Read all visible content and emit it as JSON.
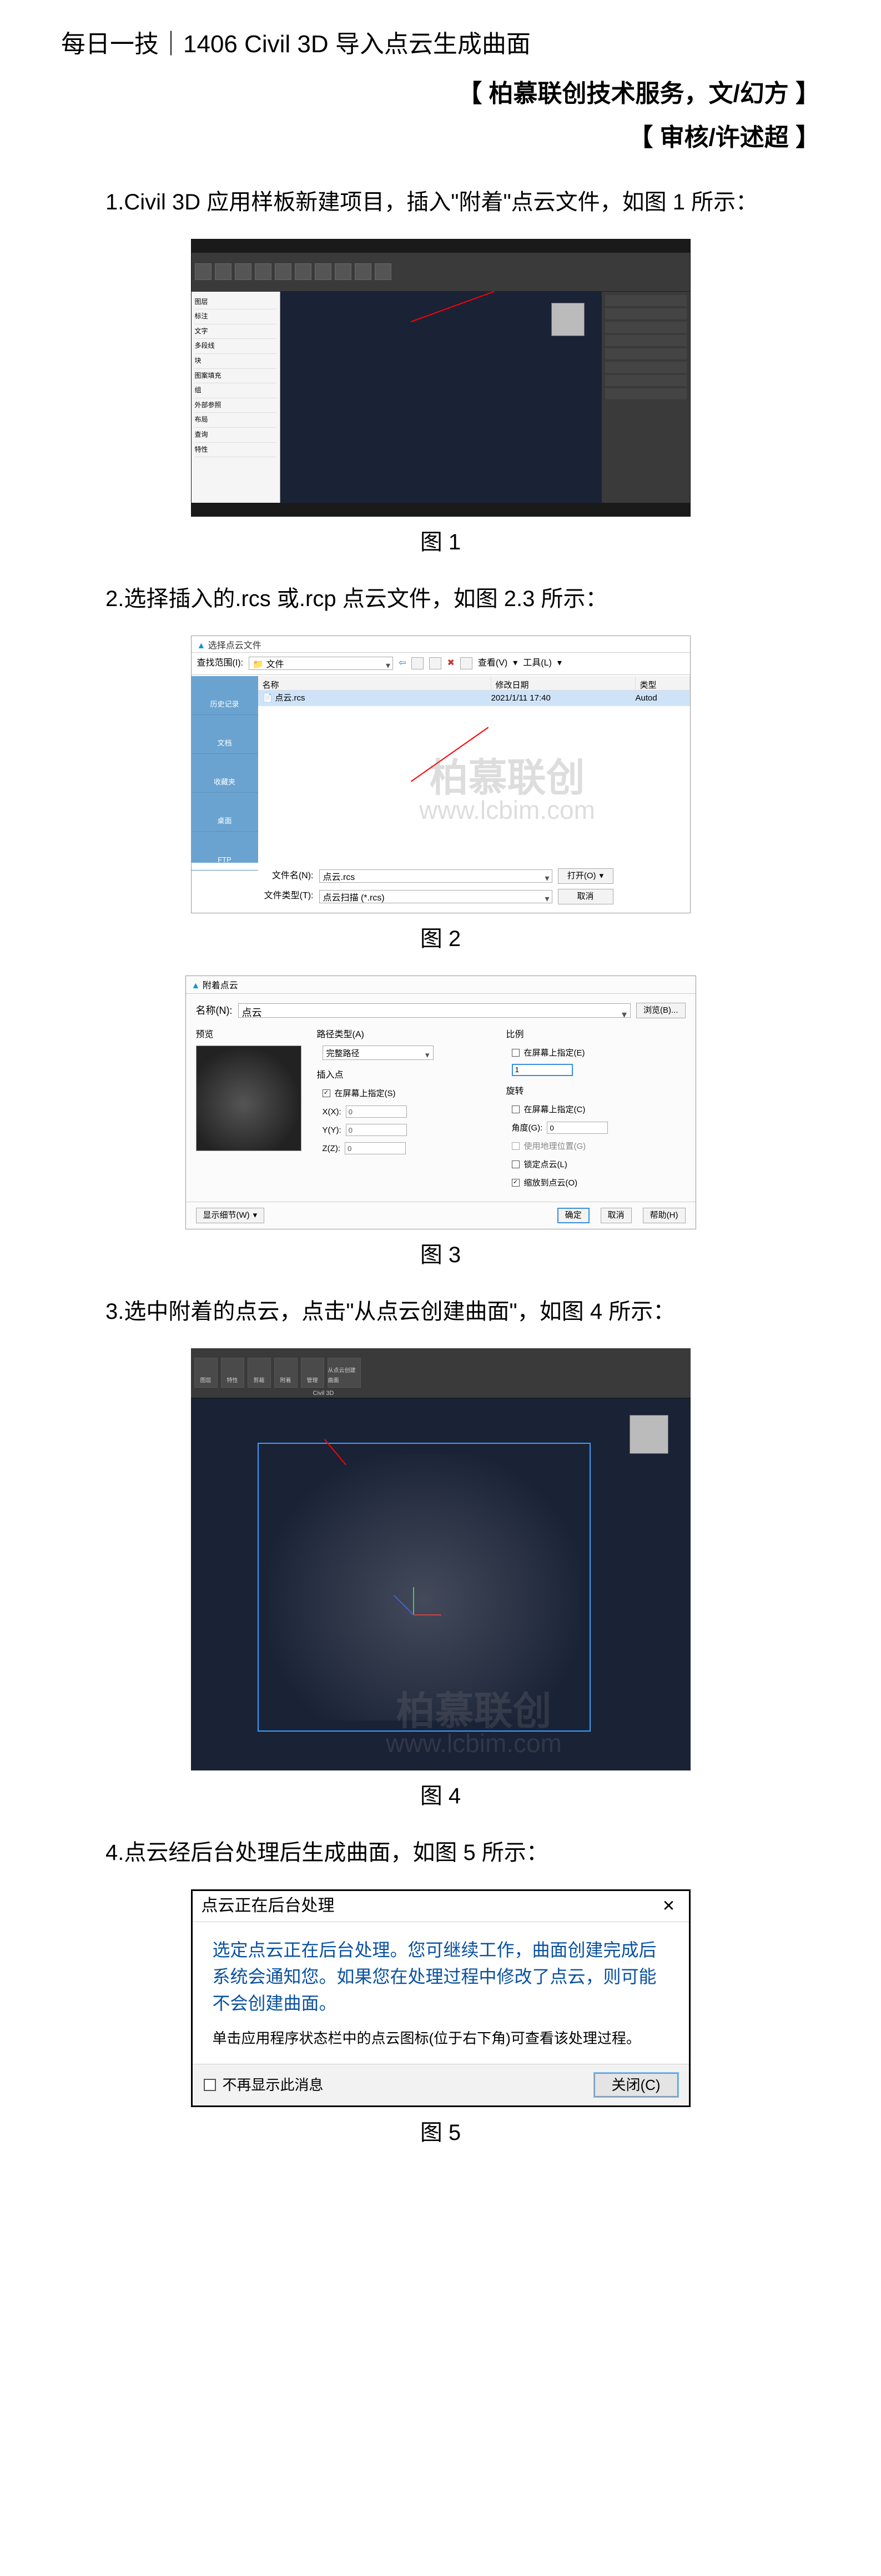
{
  "header": {
    "title": "每日一技｜1406 Civil 3D 导入点云生成曲面",
    "byline1": "【 柏慕联创技术服务，文/幻方 】",
    "byline2": "【 审核/许述超 】"
  },
  "watermark": {
    "text": "柏慕联创",
    "url": "www.lcbim.com"
  },
  "steps": {
    "s1": "1.Civil 3D 应用样板新建项目，插入\"附着\"点云文件，如图 1 所示：",
    "s2": "2.选择插入的.rcs 或.rcp 点云文件，如图 2.3 所示：",
    "s3": "3.选中附着的点云，点击\"从点云创建曲面\"，如图 4 所示：",
    "s4": "4.点云经后台处理后生成曲面，如图 5 所示："
  },
  "captions": {
    "c1": "图 1",
    "c2": "图 2",
    "c3": "图 3",
    "c4": "图 4",
    "c5": "图 5"
  },
  "fig1": {
    "tree": [
      "图层",
      "标注",
      "文字",
      "多段线",
      "块",
      "图案填充",
      "组",
      "外部参照",
      "布局",
      "查询",
      "特性"
    ]
  },
  "fig2": {
    "title": "选择点云文件",
    "lookin_label": "查找范围(I):",
    "lookin_value": "文件",
    "view_label": "查看(V)",
    "tools_label": "工具(L)",
    "headers": {
      "name": "名称",
      "date": "修改日期",
      "type": "类型"
    },
    "row": {
      "name": "点云.rcs",
      "date": "2021/1/11 17:40",
      "type": "Autod"
    },
    "places": [
      "历史记录",
      "文档",
      "收藏夹",
      "桌面",
      "FTP"
    ],
    "filename_label": "文件名(N):",
    "filename_value": "点云.rcs",
    "filetype_label": "文件类型(T):",
    "filetype_value": "点云扫描 (*.rcs)",
    "open": "打开(O)",
    "cancel": "取消"
  },
  "fig3": {
    "title": "附着点云",
    "name_label": "名称(N):",
    "name_value": "点云",
    "browse": "浏览(B)...",
    "preview_label": "预览",
    "pathtype_label": "路径类型(A)",
    "pathtype_value": "完整路径",
    "insert_label": "插入点",
    "insert_onscreen": "在屏幕上指定(S)",
    "x_label": "X(X):",
    "x_value": "0",
    "y_label": "Y(Y):",
    "y_value": "0",
    "z_label": "Z(Z):",
    "z_value": "0",
    "scale_label": "比例",
    "scale_onscreen": "在屏幕上指定(E)",
    "scale_value": "1",
    "rotate_label": "旋转",
    "rotate_onscreen": "在屏幕上指定(C)",
    "angle_label": "角度(G):",
    "angle_value": "0",
    "geo": "使用地理位置(G)",
    "lock": "锁定点云(L)",
    "zoom": "缩放到点云(O)",
    "showdetail": "显示细节(W)",
    "ok": "确定",
    "cancel": "取消",
    "help": "帮助(H)"
  },
  "fig4": {
    "ribbon": [
      "图层",
      "特性",
      "剪裁",
      "附着",
      "管理",
      "从点云创建曲面"
    ],
    "panel": "Civil 3D"
  },
  "fig5": {
    "title": "点云正在后台处理",
    "msg": "选定点云正在后台处理。您可继续工作，曲面创建完成后系统会通知您。如果您在处理过程中修改了点云，则可能不会创建曲面。",
    "note": "单击应用程序状态栏中的点云图标(位于右下角)可查看该处理过程。",
    "noremind": "不再显示此消息",
    "close": "关闭(C)"
  }
}
